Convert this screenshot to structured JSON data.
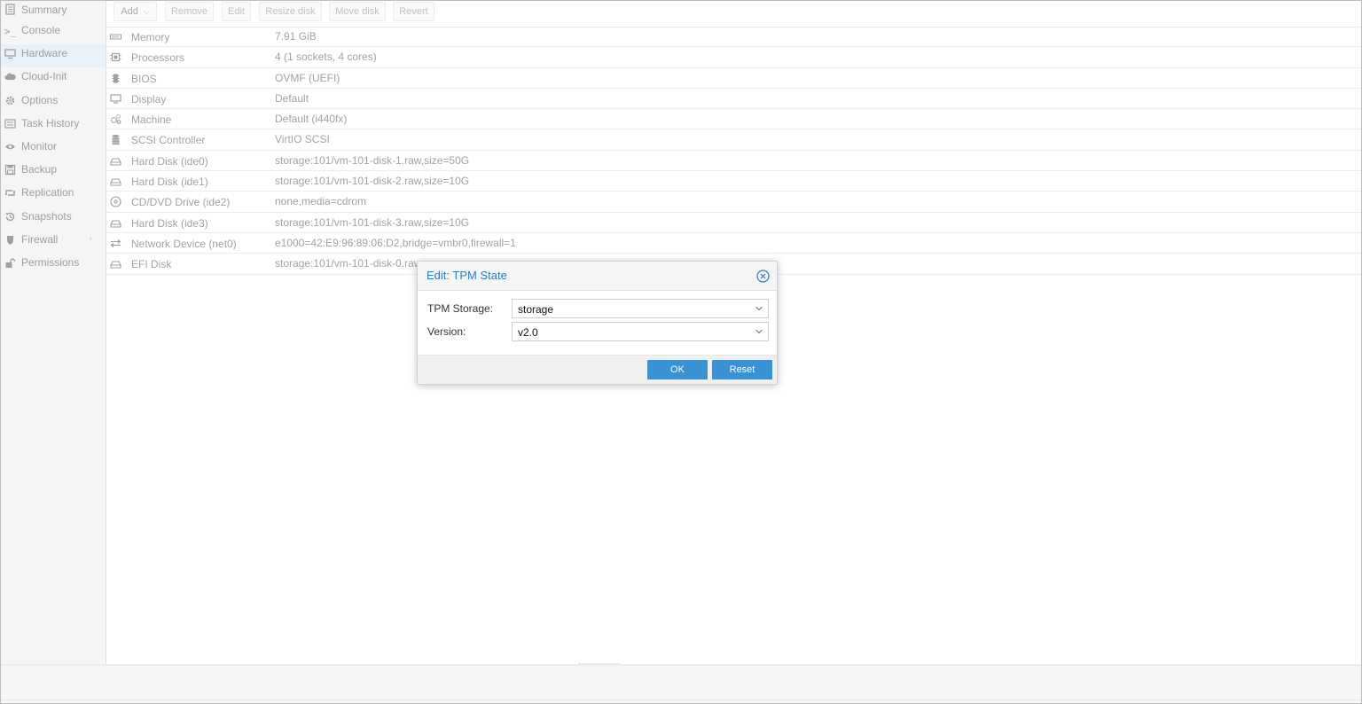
{
  "colors": {
    "accent": "#3892d4",
    "title": "#2f7ac3",
    "active_bg": "#e8f0fa"
  },
  "sidebar": {
    "items": [
      {
        "label": "Summary",
        "icon": "summary-icon"
      },
      {
        "label": "Console",
        "icon": "terminal-icon"
      },
      {
        "label": "Hardware",
        "icon": "monitor-icon",
        "active": true
      },
      {
        "label": "Cloud-Init",
        "icon": "cloud-icon"
      },
      {
        "label": "Options",
        "icon": "gear-icon"
      },
      {
        "label": "Task History",
        "icon": "list-icon"
      },
      {
        "label": "Monitor",
        "icon": "eye-icon"
      },
      {
        "label": "Backup",
        "icon": "floppy-icon"
      },
      {
        "label": "Replication",
        "icon": "retweet-icon"
      },
      {
        "label": "Snapshots",
        "icon": "history-icon"
      },
      {
        "label": "Firewall",
        "icon": "shield-icon",
        "chevron": "›"
      },
      {
        "label": "Permissions",
        "icon": "unlock-icon"
      }
    ]
  },
  "toolbar": {
    "add": "Add",
    "add_caret": "⌵",
    "remove": "Remove",
    "edit": "Edit",
    "resize_disk": "Resize disk",
    "move_disk": "Move disk",
    "revert": "Revert"
  },
  "hardware": {
    "rows": [
      {
        "icon": "memory-icon",
        "name": "Memory",
        "value": "7.91 GiB"
      },
      {
        "icon": "cpu-icon",
        "name": "Processors",
        "value": "4 (1 sockets, 4 cores)"
      },
      {
        "icon": "bios-icon",
        "name": "BIOS",
        "value": "OVMF (UEFI)"
      },
      {
        "icon": "display-icon",
        "name": "Display",
        "value": "Default"
      },
      {
        "icon": "cogs-icon",
        "name": "Machine",
        "value": "Default (i440fx)"
      },
      {
        "icon": "database-icon",
        "name": "SCSI Controller",
        "value": "VirtIO SCSI"
      },
      {
        "icon": "hdd-icon",
        "name": "Hard Disk (ide0)",
        "value": "storage:101/vm-101-disk-1.raw,size=50G"
      },
      {
        "icon": "hdd-icon",
        "name": "Hard Disk (ide1)",
        "value": "storage:101/vm-101-disk-2.raw,size=10G"
      },
      {
        "icon": "cdrom-icon",
        "name": "CD/DVD Drive (ide2)",
        "value": "none,media=cdrom"
      },
      {
        "icon": "hdd-icon",
        "name": "Hard Disk (ide3)",
        "value": "storage:101/vm-101-disk-3.raw,size=10G"
      },
      {
        "icon": "exchange-icon",
        "name": "Network Device (net0)",
        "value": "e1000=42:E9:96:89:06:D2,bridge=vmbr0,firewall=1"
      },
      {
        "icon": "hdd-icon",
        "name": "EFI Disk",
        "value": "storage:101/vm-101-disk-0.raw"
      }
    ]
  },
  "dialog": {
    "title": "Edit: TPM State",
    "close_icon": "close-circle-icon",
    "tpm_storage_label": "TPM Storage:",
    "tpm_storage_value": "storage",
    "version_label": "Version:",
    "version_value": "v2.0",
    "ok": "OK",
    "reset": "Reset"
  }
}
